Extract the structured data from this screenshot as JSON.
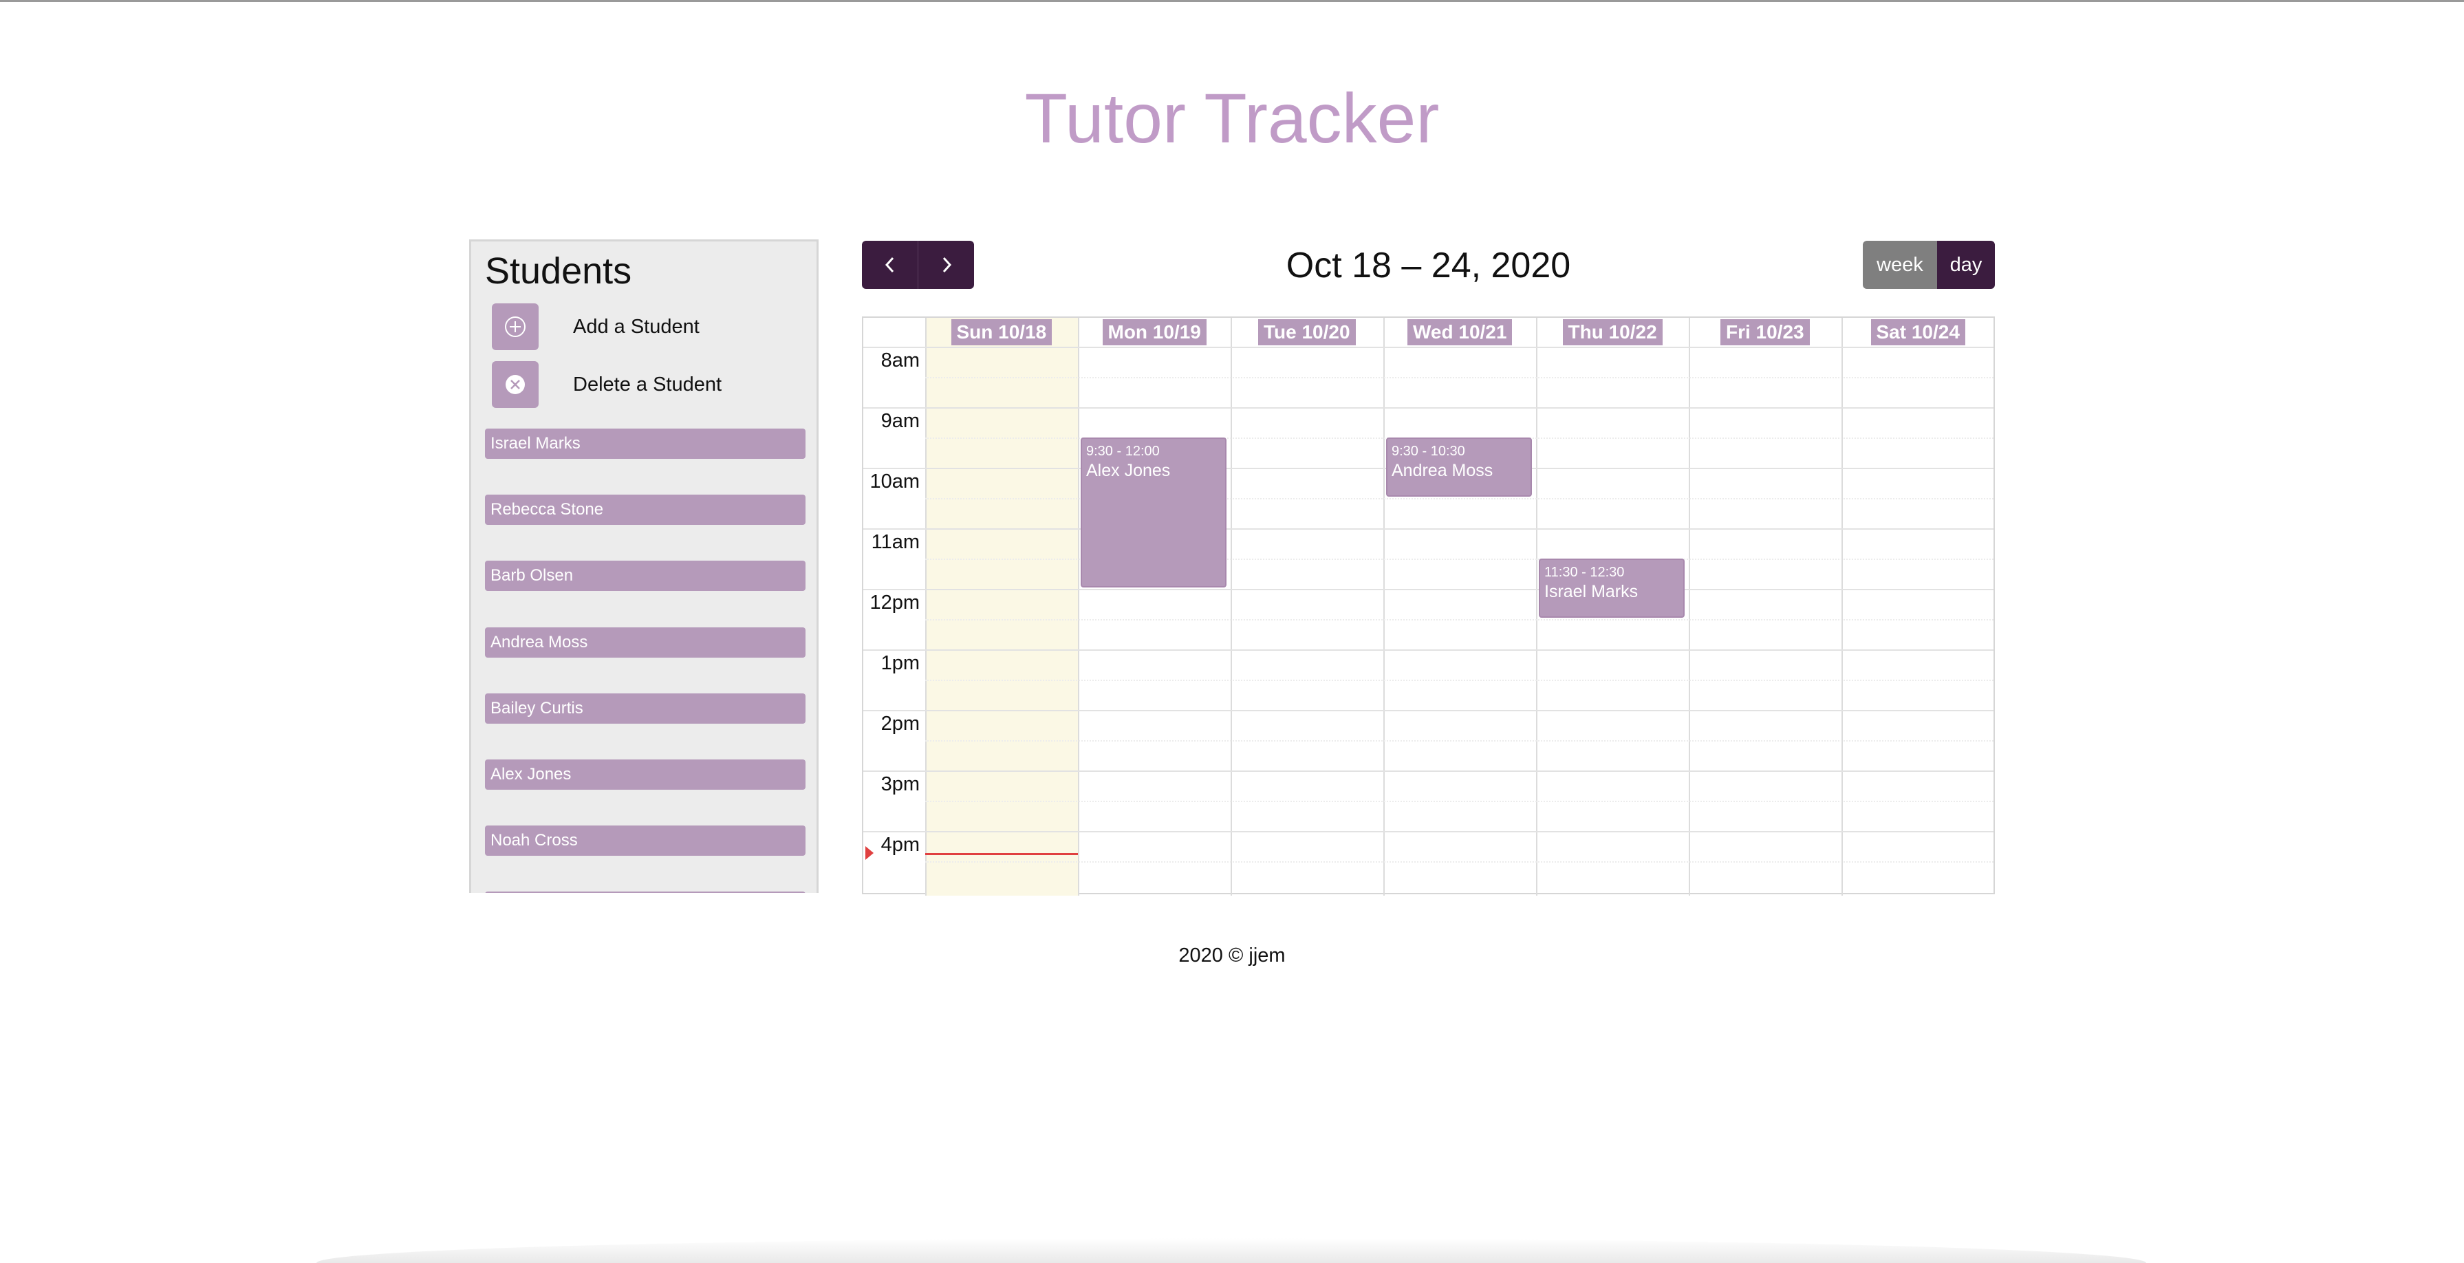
{
  "app": {
    "title": "Tutor Tracker",
    "footer": "2020 © jjem"
  },
  "sidebar": {
    "title": "Students",
    "actions": [
      {
        "label": "Add a Student",
        "icon": "plus-circle-icon"
      },
      {
        "label": "Delete a Student",
        "icon": "x-circle-icon"
      }
    ],
    "students": [
      "Israel Marks",
      "Rebecca Stone",
      "Barb Olsen",
      "Andrea Moss",
      "Bailey Curtis",
      "Alex Jones",
      "Noah Cross"
    ]
  },
  "calendar": {
    "range": "Oct 18 – 24, 2020",
    "prev_icon": "chevron-left-icon",
    "next_icon": "chevron-right-icon",
    "views": [
      "week",
      "day"
    ],
    "active_view": "day",
    "days": [
      "Sun 10/18",
      "Mon 10/19",
      "Tue 10/20",
      "Wed 10/21",
      "Thu 10/22",
      "Fri 10/23",
      "Sat 10/24"
    ],
    "today_index": 0,
    "times": [
      "8am",
      "9am",
      "10am",
      "11am",
      "12pm",
      "1pm",
      "2pm",
      "3pm",
      "4pm"
    ],
    "events": [
      {
        "day": 1,
        "time": "9:30 - 12:00",
        "name": "Alex Jones",
        "start": 9.5,
        "end": 12.0
      },
      {
        "day": 3,
        "time": "9:30 - 10:30",
        "name": "Andrea Moss",
        "start": 9.5,
        "end": 10.5
      },
      {
        "day": 4,
        "time": "11:30 - 12:30",
        "name": "Israel Marks",
        "start": 11.5,
        "end": 12.5
      }
    ],
    "colors": {
      "accent": "#b59aba",
      "nav": "#3b1c3f",
      "today": "#fbf8e5",
      "now": "#e04040",
      "title": "#c09bc7"
    }
  }
}
